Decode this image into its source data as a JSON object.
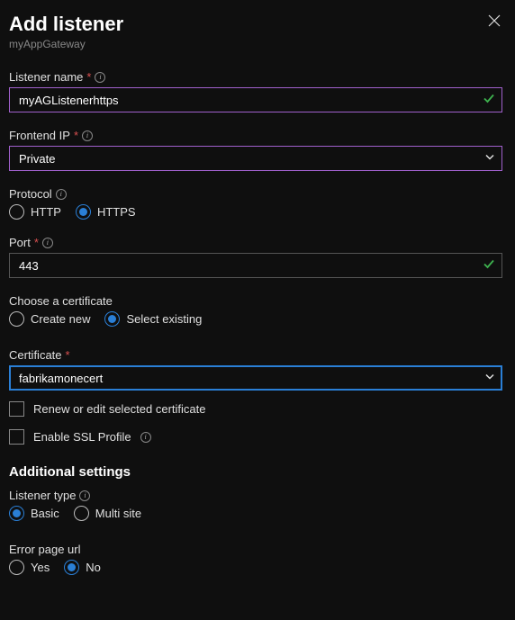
{
  "header": {
    "title": "Add listener",
    "subtitle": "myAppGateway"
  },
  "listenerName": {
    "label": "Listener name",
    "value": "myAGListenerhttps"
  },
  "frontendIp": {
    "label": "Frontend IP",
    "value": "Private"
  },
  "protocol": {
    "label": "Protocol",
    "http": "HTTP",
    "https": "HTTPS"
  },
  "port": {
    "label": "Port",
    "value": "443"
  },
  "chooseCert": {
    "label": "Choose a certificate",
    "createNew": "Create new",
    "selectExisting": "Select existing"
  },
  "certificate": {
    "label": "Certificate",
    "value": "fabrikamonecert"
  },
  "renewCert": "Renew or edit selected certificate",
  "enableSsl": "Enable SSL Profile",
  "additional": {
    "heading": "Additional settings",
    "listenerTypeLabel": "Listener type",
    "basic": "Basic",
    "multi": "Multi site",
    "errorPageLabel": "Error page url",
    "yes": "Yes",
    "no": "No"
  }
}
